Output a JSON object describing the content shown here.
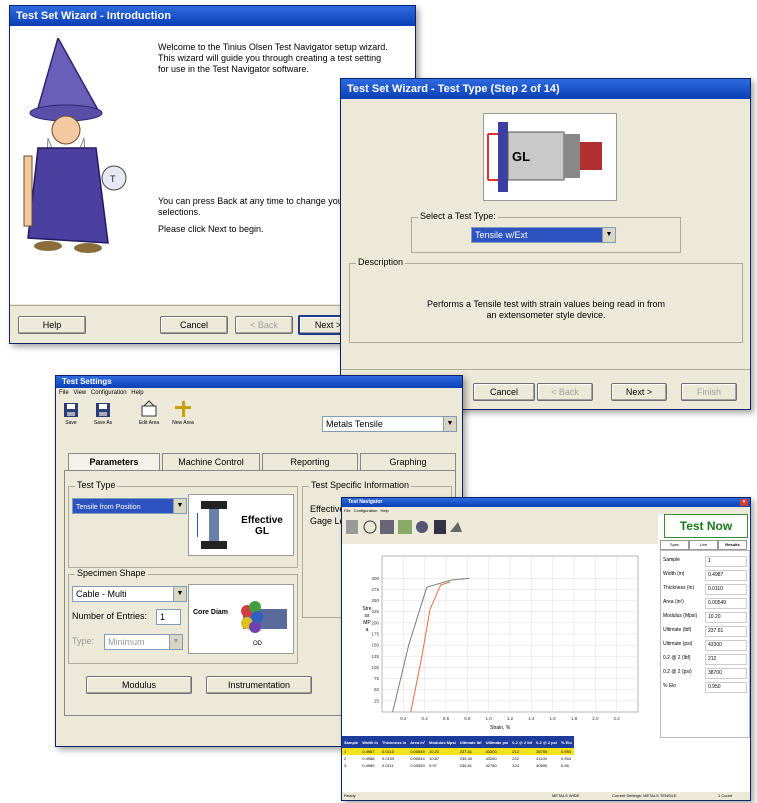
{
  "wizard1": {
    "title": "Test Set Wizard - Introduction",
    "welcome_text": "Welcome to the Tinius Olsen Test Navigator setup wizard. This wizard will guide you through creating a test setting for use in the Test Navigator software.",
    "back_text": "You can press Back at any time to change your selections.",
    "next_text": "Please click Next to begin.",
    "help_label": "Help",
    "cancel_label": "Cancel",
    "back_label": "< Back",
    "next_label": "Next >"
  },
  "wizard2": {
    "title": "Test Set Wizard - Test Type   (Step 2 of 14)",
    "gl_label": "GL",
    "select_label": "Select a Test Type:",
    "test_type_value": "Tensile w/Ext",
    "description_label": "Description",
    "description_text": "Performs a Tensile test with strain values being read in from an extensometer style device.",
    "cancel_label": "Cancel",
    "back_label": "< Back",
    "next_label": "Next >",
    "finish_label": "Finish"
  },
  "settings": {
    "title": "Test Settings",
    "menu": [
      "File",
      "View",
      "Configuration",
      "Help"
    ],
    "toolbar": [
      {
        "label": "Save",
        "icon": "save-icon"
      },
      {
        "label": "Save As",
        "icon": "save-as-icon"
      },
      {
        "label": "Edit Area",
        "icon": "edit-area-icon"
      },
      {
        "label": "New Area",
        "icon": "new-area-icon"
      }
    ],
    "area_value": "Metals Tensile",
    "tabs": [
      "Parameters",
      "Machine Control",
      "Reporting",
      "Graphing"
    ],
    "test_type_group": "Test Type",
    "test_type_value": "Tensile from Position",
    "effective_gl": "Effective GL",
    "specific_group": "Test Specific Information",
    "specific_line1": "Effective",
    "specific_line2": "Gage Le",
    "specimen_group": "Specimen Shape",
    "shape_value": "Cable - Multi",
    "entries_label": "Number of Entries:",
    "entries_value": "1",
    "type_label": "Type:",
    "type_value": "Minimum",
    "core_label": "Core Diam",
    "od_label": "OD",
    "modulus_label": "Modulus",
    "instrumentation_label": "Instrumentation"
  },
  "navigator": {
    "title": "Test Navigator",
    "menu": [
      "File",
      "Configuration",
      "Help"
    ],
    "test_now": "Test Now",
    "panel_tabs": [
      "Spec",
      "Live",
      "Results"
    ],
    "results": [
      {
        "k": "Sample",
        "v": "1"
      },
      {
        "k": "Width (in)",
        "v": "0.4987"
      },
      {
        "k": "Thickness (in)",
        "v": "0.0110"
      },
      {
        "k": "Area (in²)",
        "v": "0.00549"
      },
      {
        "k": "Modulus (Mpsi)",
        "v": "10.20"
      },
      {
        "k": "Ultimate (lbf)",
        "v": "237.61"
      },
      {
        "k": "Ultimate (psi)",
        "v": "43300"
      },
      {
        "k": "0.2 @ 2 (lbf)",
        "v": "212"
      },
      {
        "k": "0.2 @ 2 (psi)",
        "v": "38700"
      },
      {
        "k": "% Elo",
        "v": "0.950"
      }
    ],
    "y_label": "Stress MPa",
    "x_label": "Strain, %",
    "table_headers": [
      "Sample",
      "Width in",
      "Thickness in",
      "Area in²",
      "Modulus Mpsi",
      "Ultimate lbf",
      "Ultimate psi",
      "0.2 @ 2 lbf",
      "0.2 @ 2 psi",
      "% Elo"
    ],
    "table_rows": [
      [
        "1",
        "0.4987",
        "0.0110",
        "0.00549",
        "10.20",
        "237.61",
        "43300",
        "212",
        "38700",
        "0.950"
      ],
      [
        "2",
        "0.4988",
        "0.0109",
        "0.00544",
        "10.87",
        "235.30",
        "43260",
        "222",
        "41100",
        "0.954"
      ],
      [
        "3",
        "0.4989",
        "0.0111",
        "0.00553",
        "9.97",
        "236.61",
        "42780",
        "224",
        "40600",
        "0.98"
      ]
    ],
    "status_left": "Ready",
    "status_mid": "METALS WIDE",
    "status_right": "Current Settings: METALS TENSILE",
    "status_count": "1 Count"
  },
  "chart_data": {
    "type": "line",
    "xlabel": "Strain, %",
    "ylabel": "Stress MPa",
    "xlim": [
      0,
      2.4
    ],
    "ylim": [
      0,
      350
    ],
    "x_ticks": [
      0.2,
      0.4,
      0.6,
      0.8,
      1.0,
      1.2,
      1.4,
      1.6,
      1.8,
      2.0,
      2.2
    ],
    "y_ticks": [
      25,
      50,
      75,
      100,
      125,
      150,
      175,
      200,
      225,
      250,
      275,
      300
    ],
    "series": [
      {
        "x": [
          0.1,
          0.25,
          0.42,
          0.65,
          0.82
        ],
        "y": [
          0,
          150,
          280,
          296,
          300
        ]
      },
      {
        "x": [
          0.27,
          0.37,
          0.45,
          0.55,
          0.64
        ],
        "y": [
          0,
          120,
          230,
          285,
          292
        ]
      }
    ],
    "colors": [
      "#7a7a7a",
      "#e07040"
    ]
  }
}
